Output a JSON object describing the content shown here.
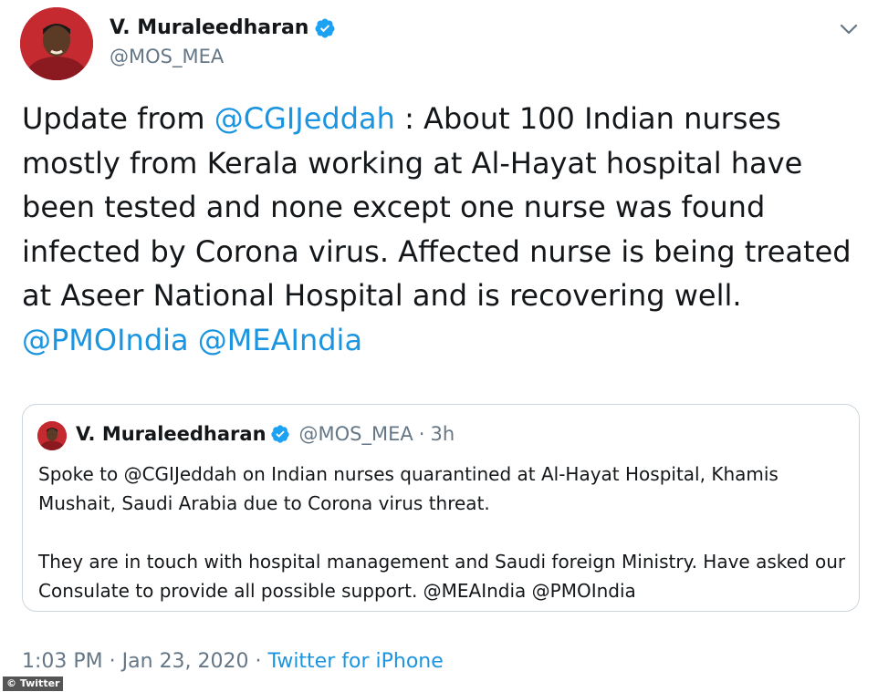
{
  "author": {
    "name": "V. Muraleedharan",
    "handle": "@MOS_MEA"
  },
  "tweet": {
    "parts": [
      {
        "text": "Update from ",
        "mention": false
      },
      {
        "text": "@CGIJeddah",
        "mention": true
      },
      {
        "text": " : About 100 Indian nurses mostly from Kerala working at Al-Hayat hospital have been tested and none except one nurse was found infected by Corona virus. Affected nurse is being treated at Aseer National Hospital and is recovering well. ",
        "mention": false
      },
      {
        "text": "@PMOIndia",
        "mention": true
      },
      {
        "text": " ",
        "mention": false
      },
      {
        "text": "@MEAIndia",
        "mention": true
      }
    ]
  },
  "quoted": {
    "name": "V. Muraleedharan",
    "handle": "@MOS_MEA",
    "separator": "·",
    "time": "3h",
    "paragraph1": "Spoke to @CGIJeddah on Indian nurses quarantined at Al-Hayat Hospital, Khamis Mushait, Saudi Arabia due to Corona virus threat.",
    "paragraph2": "They are in touch with hospital management and Saudi foreign Ministry. Have asked our Consulate to provide all possible support. @MEAIndia @PMOIndia"
  },
  "footer": {
    "time": "1:03 PM",
    "dot1": "·",
    "date": "Jan 23, 2020",
    "dot2": "·",
    "source": "Twitter for iPhone"
  },
  "credit": "© Twitter",
  "icons": {
    "verified": "verified-badge-icon",
    "menu": "chevron-down-icon"
  },
  "colors": {
    "link": "#1b95e0",
    "muted": "#657786",
    "text": "#14171a",
    "border": "#ccd6dd"
  }
}
